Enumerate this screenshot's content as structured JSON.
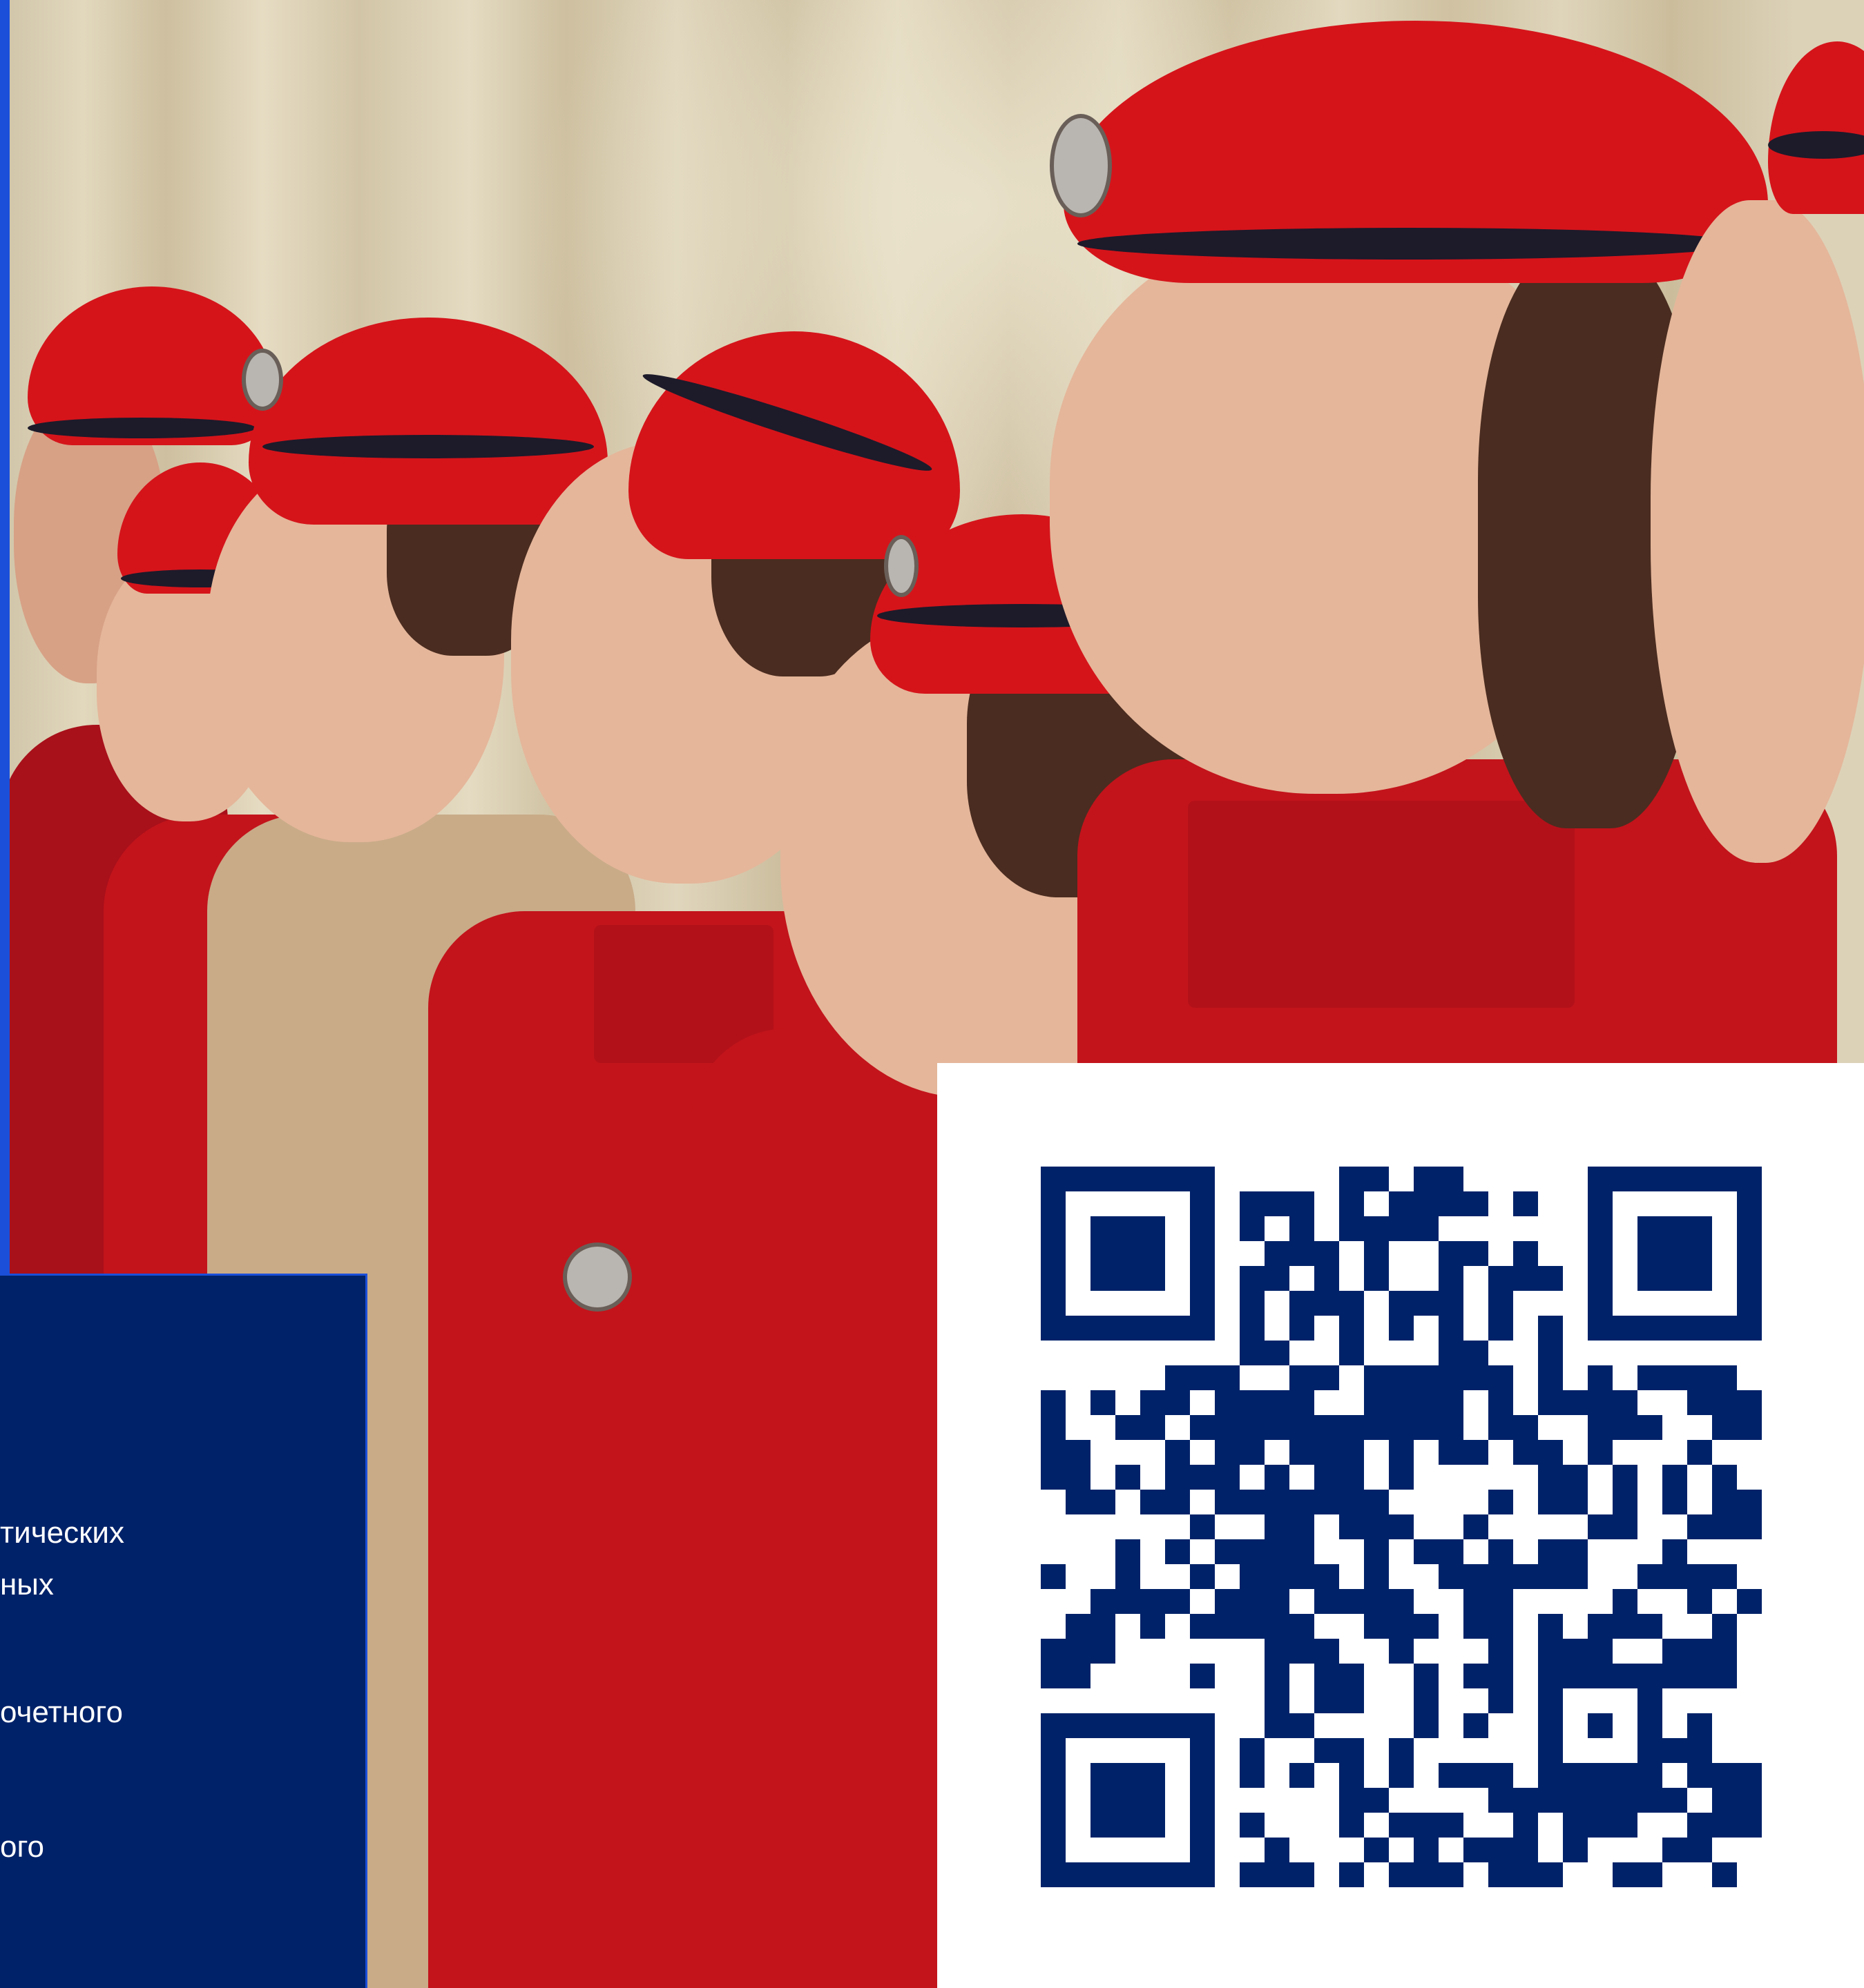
{
  "photo": {
    "subject": "young cadets in red berets and red uniforms standing in a row"
  },
  "info_panel": {
    "lines": [
      "тических",
      "ных",
      "очетного",
      "ого"
    ]
  },
  "qr": {
    "color": "#002269",
    "background": "#ffffff"
  },
  "colors": {
    "panel_navy": "#002269",
    "accent_blue": "#1b4fd9",
    "beret_red": "#d5141a",
    "uniform_red": "#c3141b"
  }
}
